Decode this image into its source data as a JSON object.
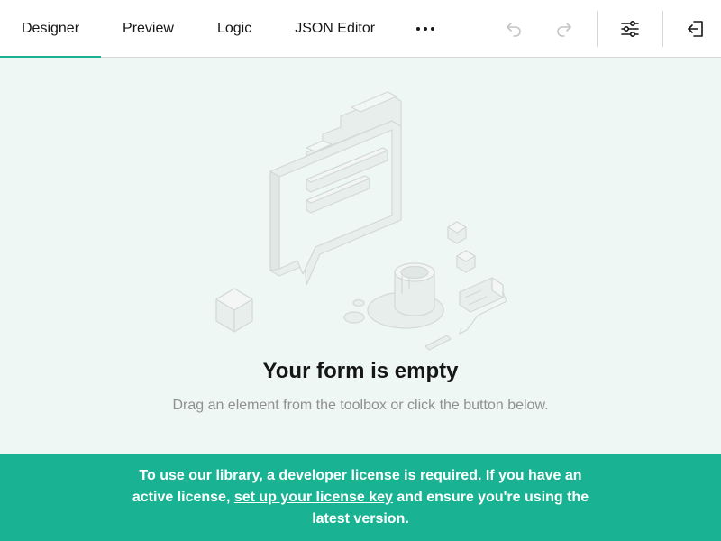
{
  "tabs": [
    {
      "label": "Designer",
      "active": true
    },
    {
      "label": "Preview",
      "active": false
    },
    {
      "label": "Logic",
      "active": false
    },
    {
      "label": "JSON Editor",
      "active": false
    }
  ],
  "toolbar": {
    "more_icon": "more-horizontal-icon",
    "undo_icon": "undo-icon",
    "redo_icon": "redo-icon",
    "settings_icon": "settings-sliders-icon",
    "exit_icon": "exit-icon",
    "undo_enabled": false,
    "redo_enabled": false
  },
  "empty_state": {
    "title": "Your form is empty",
    "subtitle": "Drag an element from the toolbox or click the button below."
  },
  "banner": {
    "text_1": "To use our library, a ",
    "link_1": "developer license",
    "text_2": " is required. If you have an active license, ",
    "link_2": "set up your license key",
    "text_3": " and ensure you're using the latest version."
  },
  "colors": {
    "accent": "#19b394",
    "text": "#161616",
    "muted": "#909090",
    "canvas": "#eef7f4"
  }
}
